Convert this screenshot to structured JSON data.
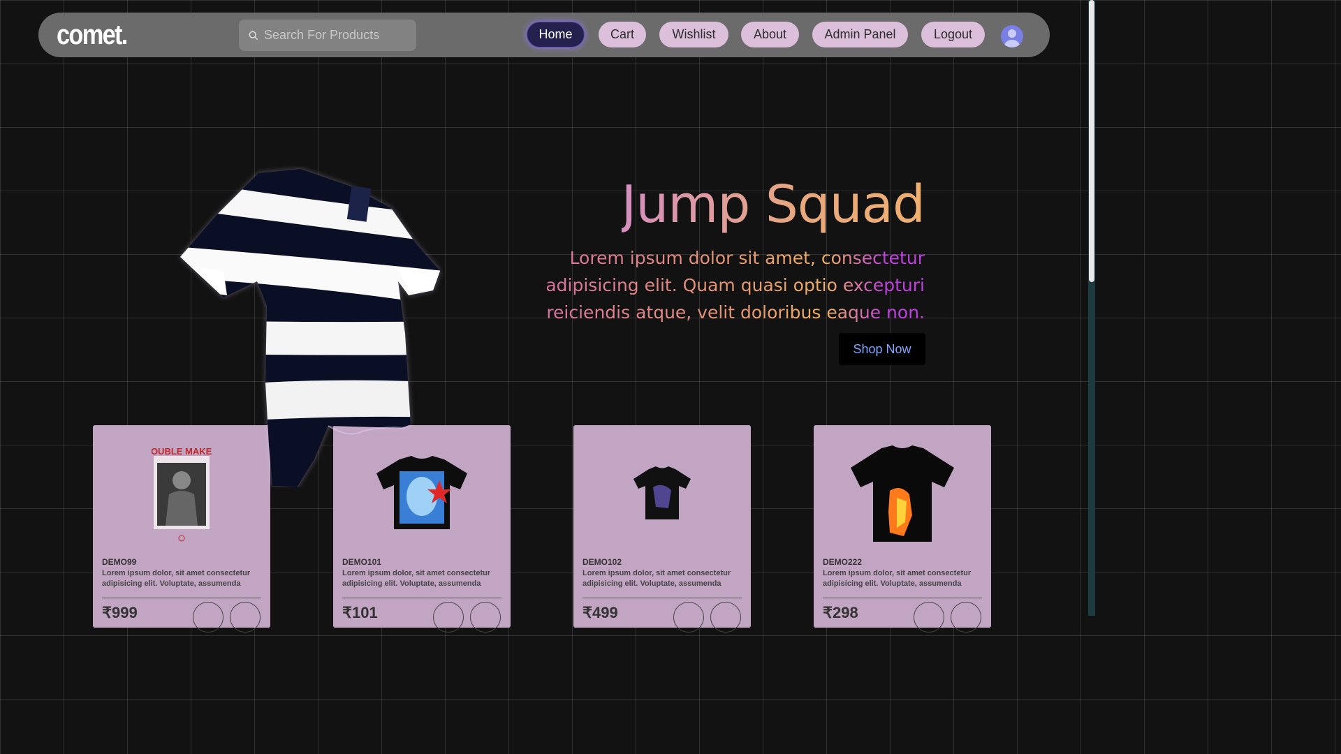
{
  "navbar": {
    "logo": "comet.",
    "search_placeholder": "Search For Products",
    "links": [
      {
        "label": "Home",
        "active": true
      },
      {
        "label": "Cart",
        "active": false
      },
      {
        "label": "Wishlist",
        "active": false
      },
      {
        "label": "About",
        "active": false
      },
      {
        "label": "Admin Panel",
        "active": false
      },
      {
        "label": "Logout",
        "active": false
      }
    ],
    "avatar_icon": "user-avatar-icon"
  },
  "hero": {
    "title": "Jump Squad",
    "description": "Lorem ipsum dolor sit amet, consectetur adipisicing elit. Quam quasi optio excepturi reiciendis atque, velit doloribus eaque non.",
    "cta_label": "Shop Now"
  },
  "products": [
    {
      "name": "DEMO99",
      "description": "Lorem ipsum dolor, sit amet consectetur adipisicing elit. Voluptate, assumenda",
      "price": "₹999"
    },
    {
      "name": "DEMO101",
      "description": "Lorem ipsum dolor, sit amet consectetur adipisicing elit. Voluptate, assumenda",
      "price": "₹101"
    },
    {
      "name": "DEMO102",
      "description": "Lorem ipsum dolor, sit amet consectetur adipisicing elit. Voluptate, assumenda",
      "price": "₹499"
    },
    {
      "name": "DEMO222",
      "description": "Lorem ipsum dolor, sit amet consectetur adipisicing elit. Voluptate, assumenda",
      "price": "₹298"
    }
  ],
  "product_image_text": {
    "demo99": "TROUBLE MAKERS"
  },
  "colors": {
    "background": "#121212",
    "navbar": "#6b6b6b",
    "nav_pill": "#dbbfdb",
    "nav_active": "#25214e",
    "card": "#c2a5c2",
    "cta_text": "#7fa8ff"
  }
}
